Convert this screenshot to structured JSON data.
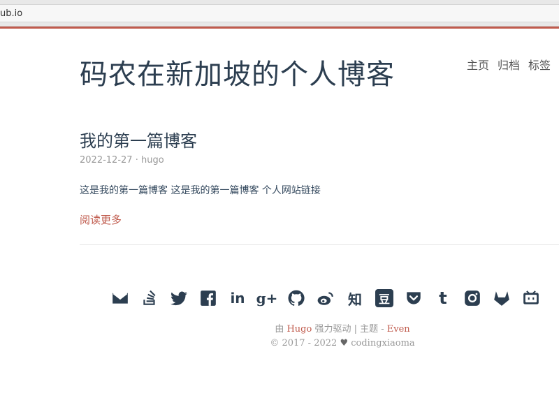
{
  "browser": {
    "url": "ub.io"
  },
  "header": {
    "site_title": "码农在新加坡的个人博客",
    "nav": [
      "主页",
      "归档",
      "标签"
    ]
  },
  "post": {
    "title": "我的第一篇博客",
    "date": "2022-12-27",
    "meta_separator": "·",
    "author": "hugo",
    "summary": "这是我的第一篇博客 这是我的第一篇博客 个人网站链接",
    "read_more": "阅读更多"
  },
  "social_icons": [
    "email-icon",
    "stack-overflow-icon",
    "twitter-icon",
    "facebook-icon",
    "linkedin-icon",
    "google-plus-icon",
    "github-icon",
    "weibo-icon",
    "zhihu-icon",
    "douban-icon",
    "pocket-icon",
    "tumblr-icon",
    "instagram-icon",
    "gitlab-icon",
    "bilibili-icon"
  ],
  "social_text": {
    "zhihu": "知",
    "douban": "豆",
    "tumblr": "t",
    "google_plus": "g+",
    "linkedin": "in"
  },
  "footer": {
    "powered_prefix": "由",
    "powered_name": "Hugo",
    "powered_mid": "强力驱动 | 主题 -",
    "theme_name": "Even",
    "copyright_years": "© 2017 - 2022",
    "author": "codingxiaoma"
  },
  "colors": {
    "accent": "#c05b4d",
    "text": "#2c3e50",
    "meta": "#999999"
  }
}
